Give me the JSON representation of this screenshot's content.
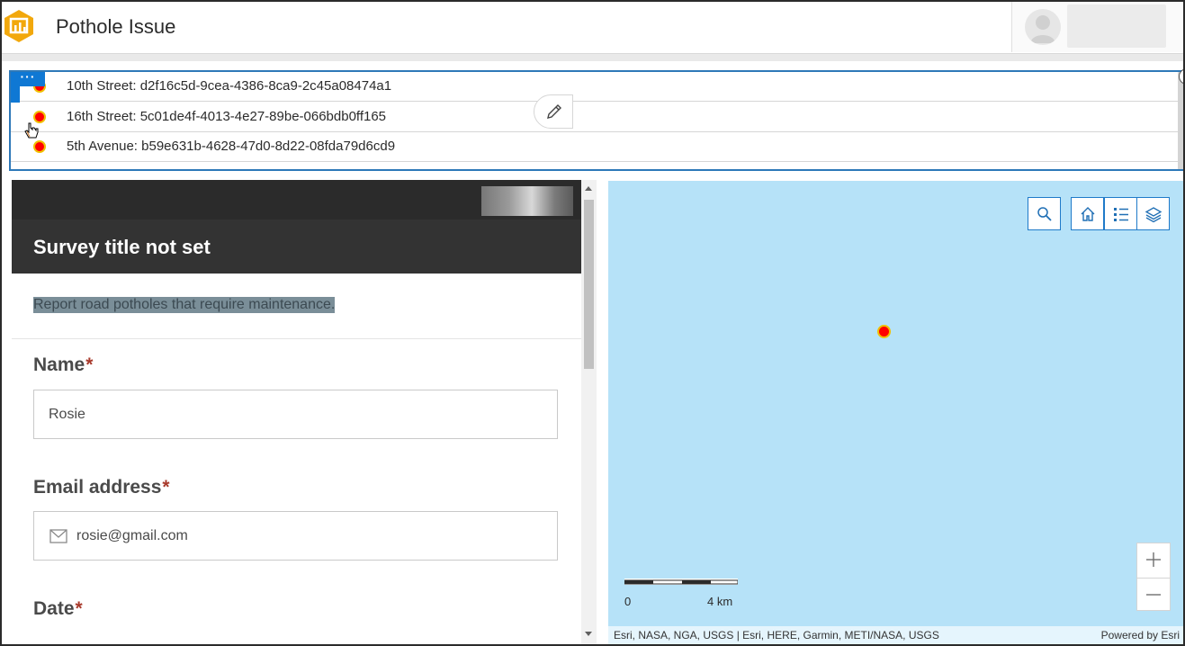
{
  "app": {
    "title": "Pothole Issue"
  },
  "list": {
    "more_label": "···",
    "rows": [
      {
        "text": "10th Street: d2f16c5d-9cea-4386-8ca9-2c45a08474a1"
      },
      {
        "text": "16th Street: 5c01de4f-4013-4e27-89be-066bdb0ff165"
      },
      {
        "text": "5th Avenue: b59e631b-4628-47d0-8d22-08fda79d6cd9"
      }
    ]
  },
  "survey": {
    "title": "Survey title not set",
    "description": "Report road potholes that require maintenance.",
    "questions": [
      {
        "label": "Name",
        "required_mark": "*",
        "value": "Rosie"
      },
      {
        "label": "Email address",
        "required_mark": "*",
        "value": "rosie@gmail.com"
      },
      {
        "label": "Date",
        "required_mark": "*"
      }
    ]
  },
  "map": {
    "scale_start": "0",
    "scale_end": "4 km",
    "attribution": "Esri, NASA, NGA, USGS | Esri, HERE, Garmin, METI/NASA, USGS",
    "powered_by": "Powered by Esri",
    "zoom_in": "+",
    "zoom_out": "—",
    "tools": [
      "search-icon",
      "home-icon",
      "legend-icon",
      "layers-icon"
    ]
  },
  "colors": {
    "accent": "#0f78d4",
    "map_water": "#b6e2f8",
    "point_fill": "#ff0000",
    "point_outline": "#f0c000",
    "header_dark": "#333333"
  }
}
